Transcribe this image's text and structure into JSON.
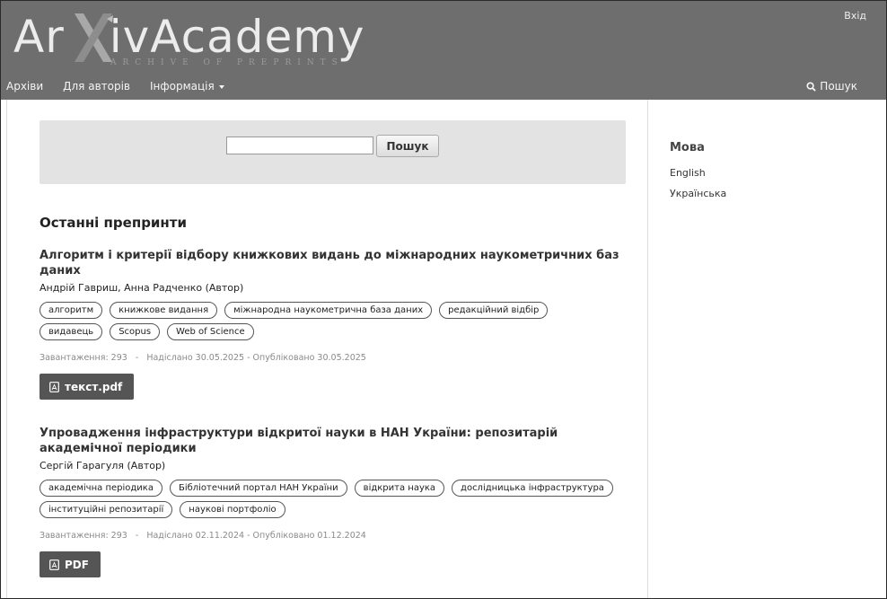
{
  "header": {
    "logo_text": "ArXivAcademy",
    "logo_subtitle": "ARCHIVE OF PREPRINTS",
    "login_label": "Вхід",
    "nav": [
      "Архіви",
      "Для авторів",
      "Інформація"
    ],
    "search_label": "Пошук",
    "colors": {
      "header_bg": "#6e6e6e",
      "button_dark": "#555555"
    }
  },
  "search": {
    "value": "",
    "button_label": "Пошук"
  },
  "main": {
    "section_title": "Останні препринти",
    "articles": [
      {
        "title": "Алгоритм і критерії відбору книжкових видань до міжнародних наукометричних баз даних",
        "authors": "Андрій Гавриш, Анна Радченко (Автор)",
        "keywords": [
          "алгоритм",
          "книжкове видання",
          "міжнародна наукометрична база даних",
          "редакційний відбір",
          "видавець",
          "Scopus",
          "Web of Science"
        ],
        "meta": "Завантаження: 293   -   Надіслано 30.05.2025 - Опубліковано 30.05.2025",
        "galley_label": "текст.pdf"
      },
      {
        "title": "Упровадження інфраструктури відкритої науки в НАН України: репозитарій академічної періодики",
        "authors": "Сергій Гарагуля (Автор)",
        "keywords": [
          "академічна періодика",
          "Бібліотечний портал НАН України",
          "відкрита наука",
          "дослідницька інфраструктура",
          "інституційні репозитарії",
          "наукові портфоліо"
        ],
        "meta": "Завантаження: 293   -   Надіслано 02.11.2024 - Опубліковано 01.12.2024",
        "galley_label": "PDF"
      }
    ]
  },
  "sidebar": {
    "language_title": "Мова",
    "languages": [
      "English",
      "Українська"
    ]
  }
}
